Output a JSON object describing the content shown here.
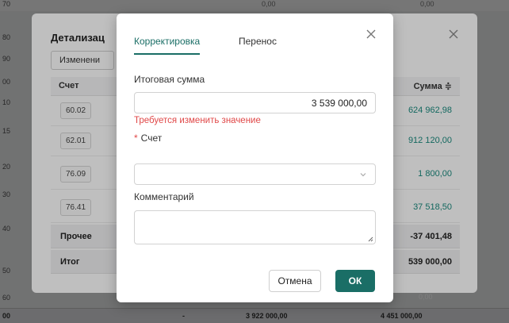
{
  "background": {
    "row_numbers": [
      "70",
      "80",
      "90",
      "00",
      "10",
      "15",
      "20",
      "30",
      "40",
      "50",
      "60",
      "00"
    ],
    "bottom_values": [
      "-",
      "3 922 000,00",
      "4 451 000,00"
    ],
    "top_strip_values": [
      "0,00",
      "0,00"
    ],
    "grey_value": "0,00"
  },
  "back_dialog": {
    "title": "Детализац",
    "tab_button": "Изменени",
    "col_account": "Счет",
    "col_sum": "Сумма ≑",
    "rows": [
      {
        "account": "60.02",
        "sum": "624 962,98"
      },
      {
        "account": "62.01",
        "sum": "912 120,00"
      },
      {
        "account": "76.09",
        "sum": "1 800,00"
      },
      {
        "account": "76.41",
        "sum": "37 518,50"
      }
    ],
    "other_label": "Прочее",
    "other_value": "-37 401,48",
    "total_label": "Итог",
    "total_value": "539 000,00"
  },
  "dialog": {
    "tabs": [
      {
        "label": "Корректировка",
        "active": true
      },
      {
        "label": "Перенос",
        "active": false
      }
    ],
    "amount_label": "Итоговая сумма",
    "amount_value": "3 539 000,00",
    "error_text": "Требуется изменить значение",
    "account_required_mark": "*",
    "account_label": "Счет",
    "account_value": "",
    "comment_label": "Комментарий",
    "comment_value": "",
    "cancel_label": "Отмена",
    "ok_label": "ОК"
  },
  "colors": {
    "accent": "#1a6e66",
    "error": "#e04848",
    "sum_text": "#1a8b7f"
  },
  "icons": {
    "close": "close-icon",
    "chevron": "chevron-down-icon",
    "sort": "sort-icon",
    "resize": "resize-grip-icon"
  }
}
